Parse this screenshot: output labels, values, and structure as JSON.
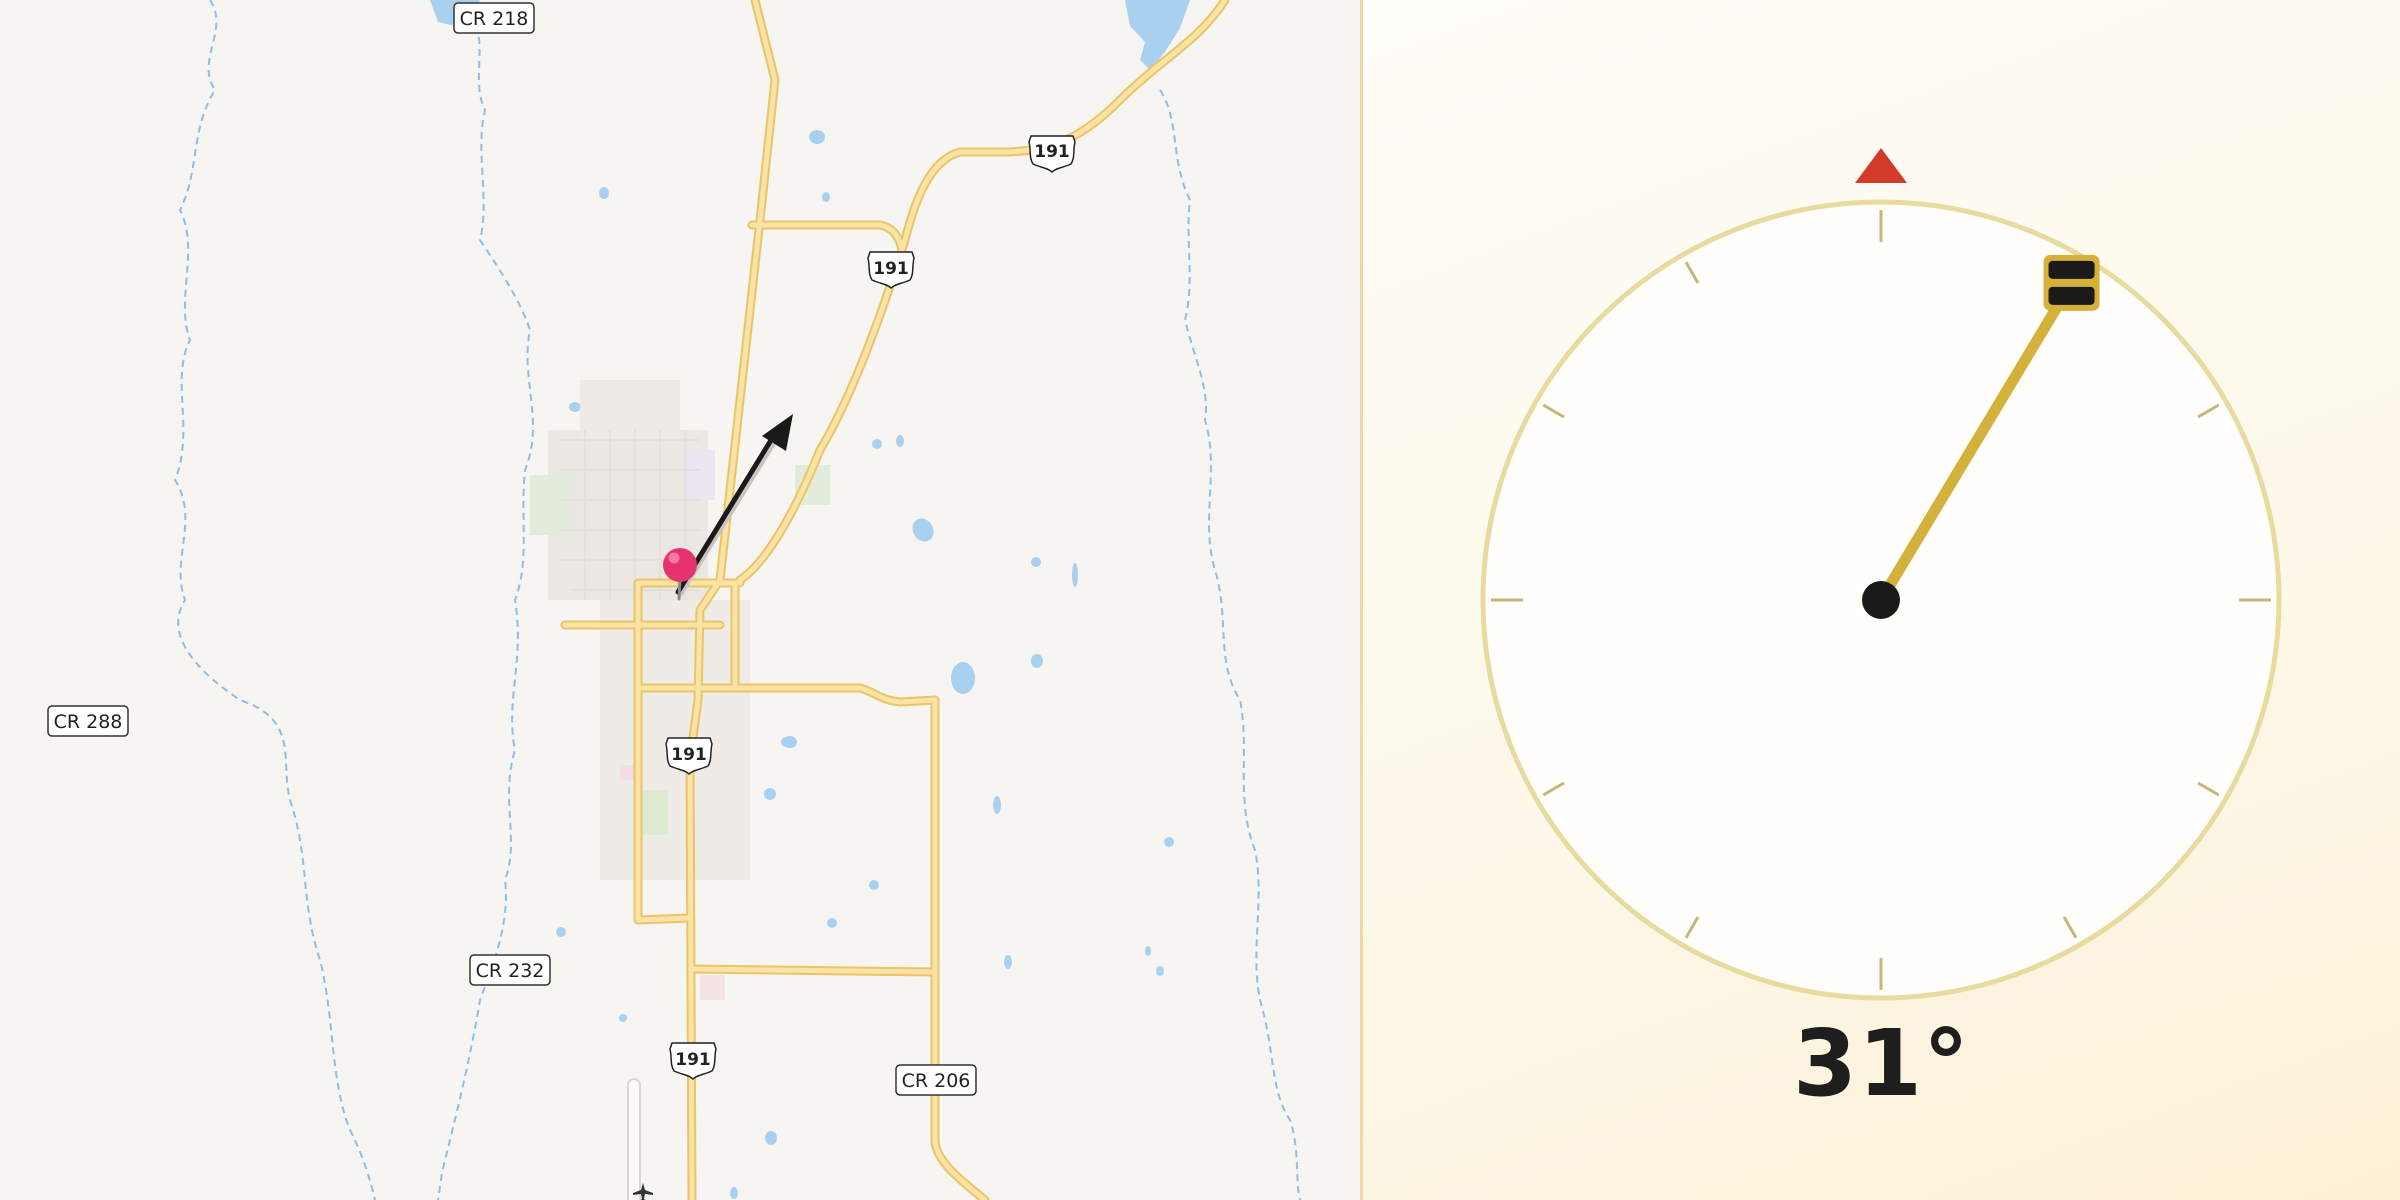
{
  "map": {
    "road_labels": [
      "CR 218",
      "CR 288",
      "CR 232",
      "CR 206"
    ],
    "shield_labels": [
      "191",
      "191",
      "191",
      "191"
    ],
    "colors": {
      "background": "#f7f5f2",
      "road_fill": "#fbe3a6",
      "road_casing": "#e9c46a",
      "stream": "#8fbde6",
      "water": "#a9d1ef",
      "town_blocks": "#ebe8e4",
      "pin": "#e6336e",
      "arrow": "#1a1a1a"
    },
    "marker": "location-pin-icon",
    "direction_arrow": "heading-arrow-icon"
  },
  "compass": {
    "heading_degrees": 31,
    "heading_text": "31°",
    "north_marker": "north-triangle-icon",
    "colors": {
      "ring": "#e8dba0",
      "tick": "#c9b57a",
      "needle": "#d4b13b",
      "north": "#d23a2c",
      "hub": "#1a1a1a",
      "face": "#fffefb"
    }
  }
}
